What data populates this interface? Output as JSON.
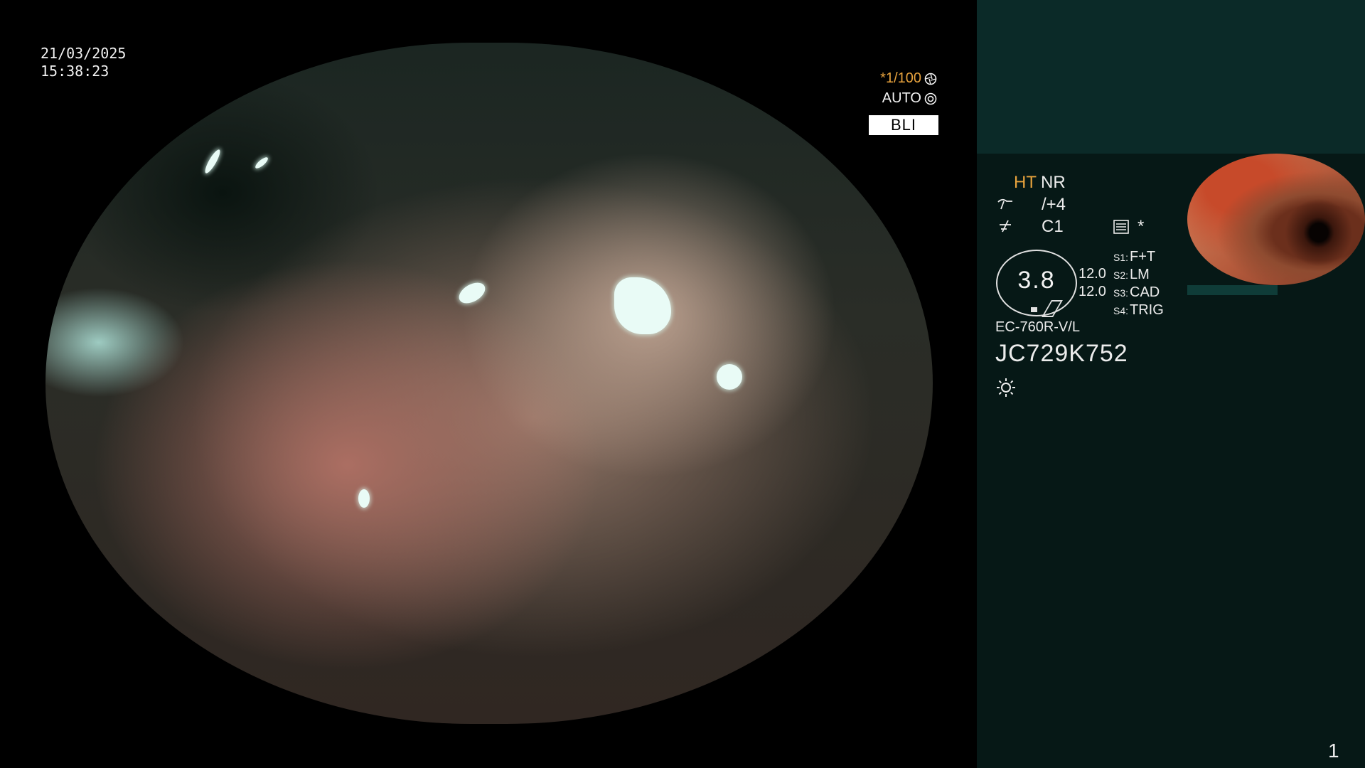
{
  "overlay": {
    "date": "21/03/2025",
    "time": "15:38:23",
    "shutter": "*1/100",
    "exposure_mode": "AUTO",
    "mode_badge": "BLI"
  },
  "panel": {
    "ht_label": "HT",
    "nr_label": "NR",
    "enhancement": "/+4",
    "color_mode": "C1",
    "star": "*",
    "magnification": "3.8",
    "value_1": "12.0",
    "value_2": "12.0",
    "switches": [
      {
        "key": "S1:",
        "value": "F+T"
      },
      {
        "key": "S2:",
        "value": "LM"
      },
      {
        "key": "S3:",
        "value": "CAD"
      },
      {
        "key": "S4:",
        "value": "TRIG"
      }
    ],
    "scope_model": "EC-760R-V/L",
    "scope_serial": "JC729K752",
    "page_number": "1"
  },
  "colors": {
    "accent_orange": "#e7a23d",
    "panel_top": "#0b2a28",
    "panel_bottom": "#061816"
  },
  "icons": {
    "shutter": "aperture-icon",
    "auto": "iris-icon",
    "enhancement": "enhancement-icon",
    "color": "color-icon",
    "settings": "settings-icon",
    "light": "sun-icon"
  }
}
